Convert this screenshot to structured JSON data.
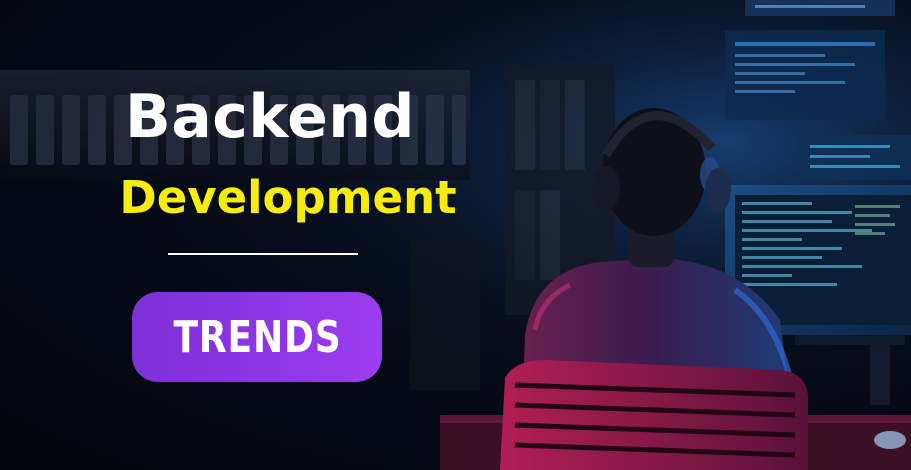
{
  "banner": {
    "title_line1": "Backend",
    "title_line2": "Development",
    "badge_label": "TRENDS"
  },
  "colors": {
    "title_primary": "#ffffff",
    "title_accent": "#f7ec10",
    "badge_start": "#7d2fd8",
    "badge_end": "#9c3df0",
    "background": "#02040a"
  }
}
